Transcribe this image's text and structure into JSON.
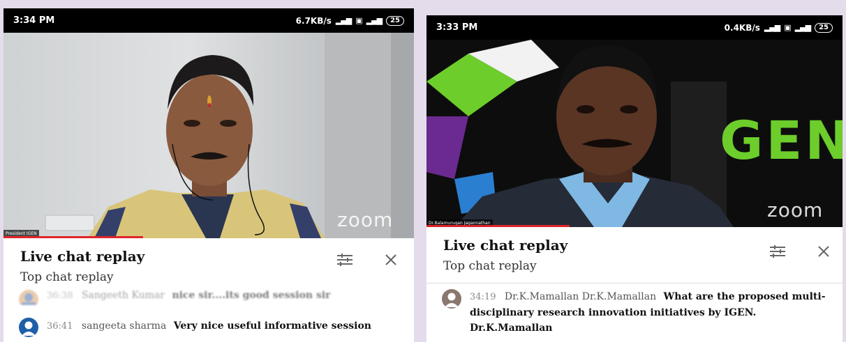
{
  "left": {
    "status": {
      "time": "3:34 PM",
      "network_speed": "6.7KB/s",
      "battery": "25"
    },
    "video": {
      "participant_name": "President IGEN",
      "logo_text": "zoom",
      "playback_fraction": 0.34
    },
    "chat": {
      "title": "Live chat replay",
      "subtitle": "Top chat replay",
      "messages": [
        {
          "time": "36:38",
          "author": "Sangeeth Kumar",
          "text": "nice sir....its good session sir"
        },
        {
          "time": "36:41",
          "author": "sangeeta sharma",
          "text": "Very nice useful informative session"
        }
      ]
    }
  },
  "right": {
    "status": {
      "time": "3:33 PM",
      "network_speed": "0.4KB/s",
      "battery": "25"
    },
    "video": {
      "participant_name": "Dr.Balamurugan Jagannathan",
      "logo_text": "zoom",
      "backdrop_text": "GEN",
      "playback_fraction": 0.34
    },
    "chat": {
      "title": "Live chat replay",
      "subtitle": "Top chat replay",
      "messages": [
        {
          "time": "34:19",
          "author": "Dr.K.Mamallan Dr.K.Mamallan",
          "text": "What are the proposed multi-disciplinary research innovation initiatives by IGEN. Dr.K.Mamallan"
        }
      ]
    }
  },
  "colors": {
    "accent_red": "#e0242b",
    "backdrop": "#e4dcea",
    "gen_green": "#6ccd2b"
  }
}
